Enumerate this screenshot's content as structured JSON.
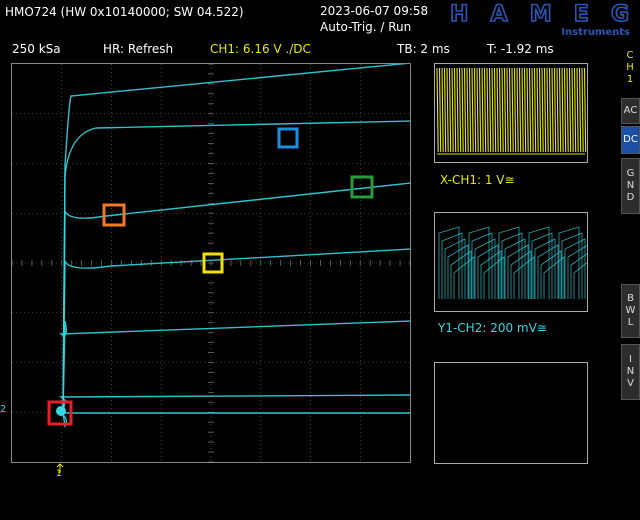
{
  "header": {
    "device": "HMO724 (HW 0x10140000; SW 04.522)",
    "datetime": "2023-06-07 09:58",
    "trigger_mode": "Auto-Trig. / Run",
    "brand": "HAMEG",
    "brand_sub": "Instruments"
  },
  "status": {
    "sample_rate": "250 kSa",
    "hr_mode": "HR: Refresh",
    "ch1_trigger": "CH1: 6.16 V ./DC",
    "timebase": "TB: 2 ms",
    "trigger_time": "T: -1.92 ms"
  },
  "panels": {
    "xch1_label": "X-CH1: 1 V≅",
    "ych2_label": "Y1-CH2: 200 mV≅"
  },
  "side": {
    "ch1_tag": [
      "C",
      "H",
      "1"
    ],
    "ac": "AC",
    "dc": "DC",
    "gnd": [
      "G",
      "N",
      "D"
    ],
    "bwl": [
      "B",
      "W",
      "L"
    ],
    "inv": [
      "I",
      "N",
      "V"
    ]
  },
  "markers": {
    "ch2_ref": "2",
    "trigger_pos": "1"
  },
  "colors": {
    "trace_cyan": "#35d7e0",
    "trace_yellow": "#e6e61a",
    "grid": "#6a6a6a",
    "marker_red": "#e8202a",
    "marker_orange": "#f07a28",
    "marker_blue": "#1b8fe0",
    "marker_green": "#2a9d3a",
    "marker_yellow": "#f2e000",
    "ch1_label": "#e8e800",
    "ch2_label": "#35d7e0"
  }
}
